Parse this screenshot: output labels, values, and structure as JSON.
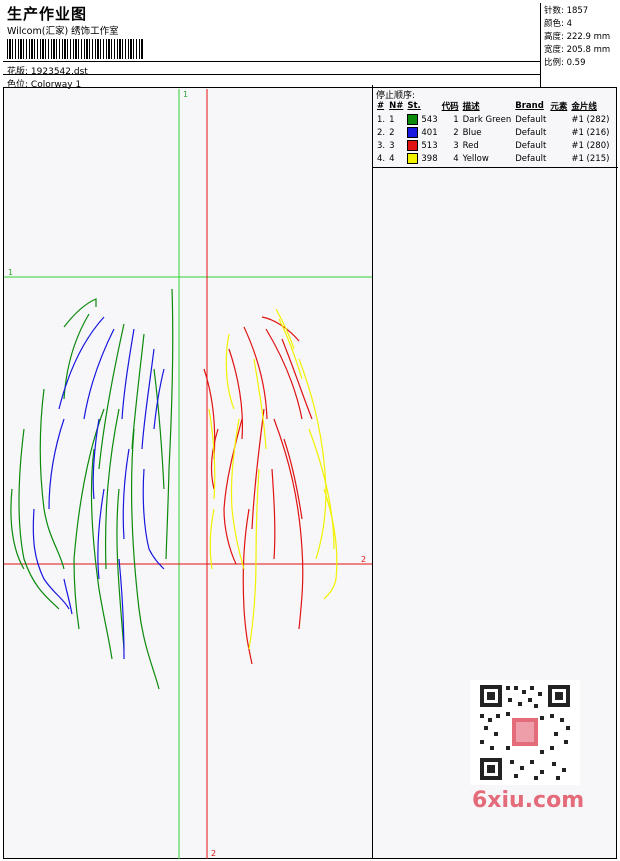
{
  "header": {
    "title": "生产作业图",
    "company": "Wilcom(汇家) 绣饰工作室",
    "pattern_label": "花版:",
    "pattern_value": "1923542.dst",
    "colorway_label": "色位:",
    "colorway_value": "Colorway 1"
  },
  "stats": {
    "stitches": "针数: 1857",
    "colors": "颜色: 4",
    "height": "高度: 222.9 mm",
    "width": "宽度: 205.8 mm",
    "scale": "比例: 0.59"
  },
  "stop_sequence": {
    "heading": "停止顺序:",
    "columns": [
      "#",
      "N#",
      "St.",
      "代码",
      "描述",
      "Brand",
      "元素",
      "金片线"
    ],
    "rows": [
      {
        "num": "1.",
        "n": "1",
        "color": "#0c8a0c",
        "st": "543",
        "code": "1",
        "desc": "Dark Green",
        "brand": "Default",
        "elem": "",
        "seq": "#1 (282)"
      },
      {
        "num": "2.",
        "n": "2",
        "color": "#1717e0",
        "st": "401",
        "code": "2",
        "desc": "Blue",
        "brand": "Default",
        "elem": "",
        "seq": "#1 (216)"
      },
      {
        "num": "3.",
        "n": "3",
        "color": "#e01212",
        "st": "513",
        "code": "3",
        "desc": "Red",
        "brand": "Default",
        "elem": "",
        "seq": "#1 (280)"
      },
      {
        "num": "4.",
        "n": "4",
        "color": "#f2f200",
        "st": "398",
        "code": "4",
        "desc": "Yellow",
        "brand": "Default",
        "elem": "",
        "seq": "#1 (215)"
      }
    ]
  },
  "guides": {
    "label_1": "1",
    "label_2": "2"
  },
  "watermark": {
    "text": "6xiu.com"
  }
}
